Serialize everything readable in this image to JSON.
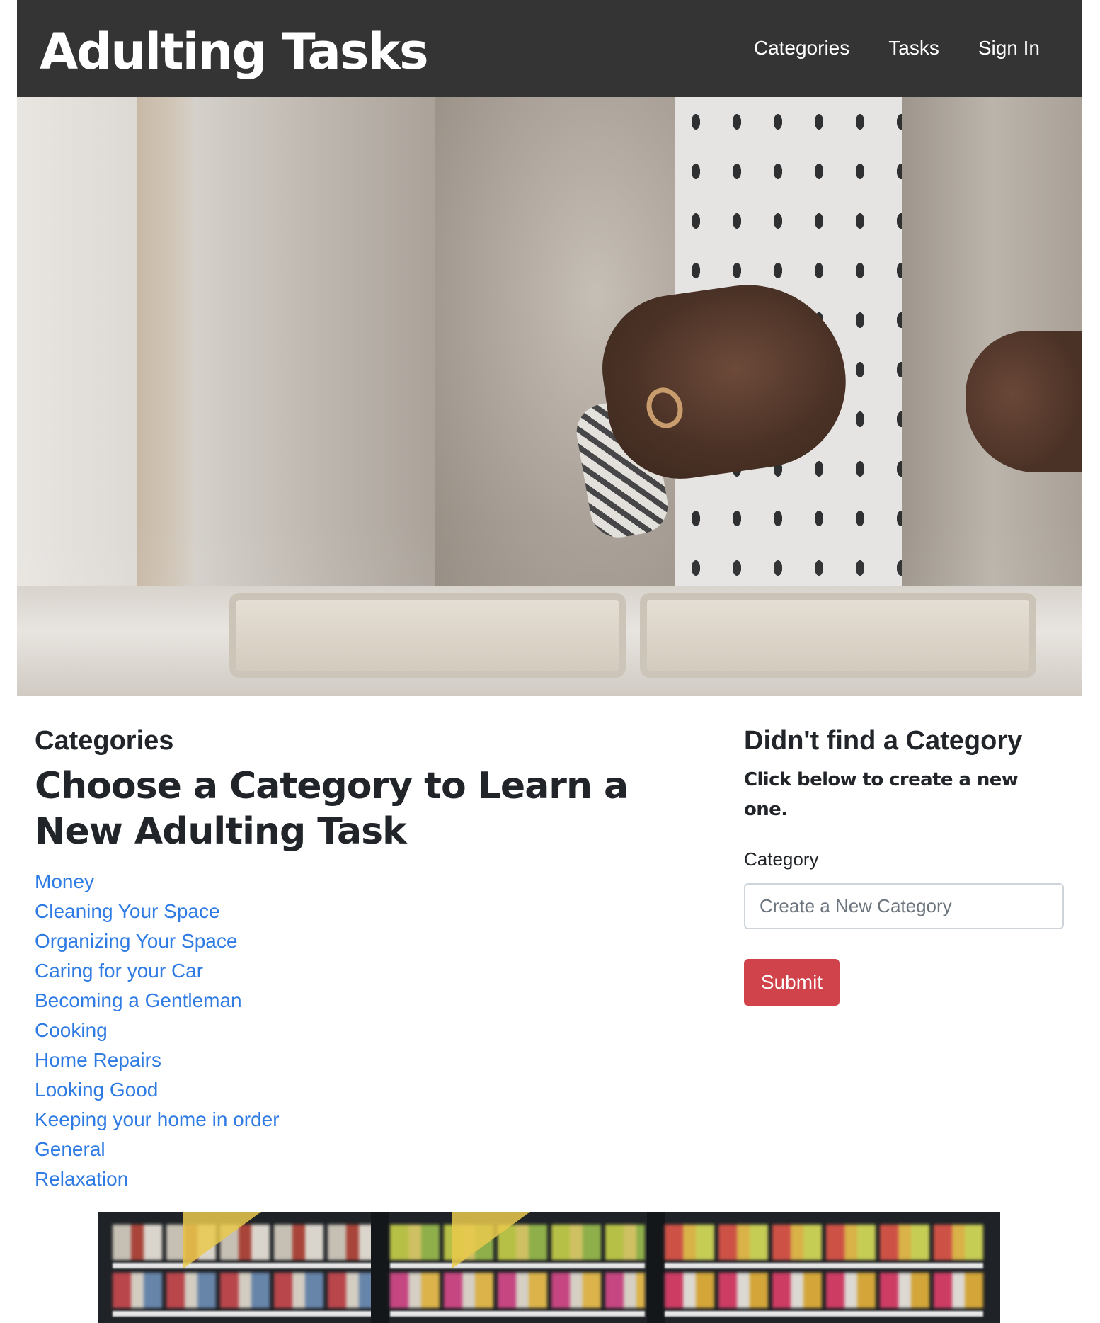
{
  "header": {
    "brand": "Adulting Tasks",
    "nav": [
      {
        "label": "Categories"
      },
      {
        "label": "Tasks"
      },
      {
        "label": "Sign In"
      }
    ]
  },
  "main": {
    "section_label": "Categories",
    "heading": "Choose a Category to Learn a New Adulting Task",
    "categories": [
      {
        "label": "Money"
      },
      {
        "label": "Cleaning Your Space"
      },
      {
        "label": "Organizing Your Space"
      },
      {
        "label": "Caring for your Car"
      },
      {
        "label": "Becoming a Gentleman"
      },
      {
        "label": "Cooking"
      },
      {
        "label": "Home Repairs"
      },
      {
        "label": "Looking Good"
      },
      {
        "label": "Keeping your home in order"
      },
      {
        "label": "General"
      },
      {
        "label": "Relaxation"
      }
    ]
  },
  "sidebar": {
    "heading": "Didn't find a Category",
    "subheading": "Click below to create a new one.",
    "field_label": "Category",
    "input_placeholder": "Create a New Category",
    "input_value": "",
    "submit_label": "Submit"
  },
  "colors": {
    "navbar_bg": "#343434",
    "link": "#2f7be4",
    "submit_bg": "#d1434a"
  }
}
